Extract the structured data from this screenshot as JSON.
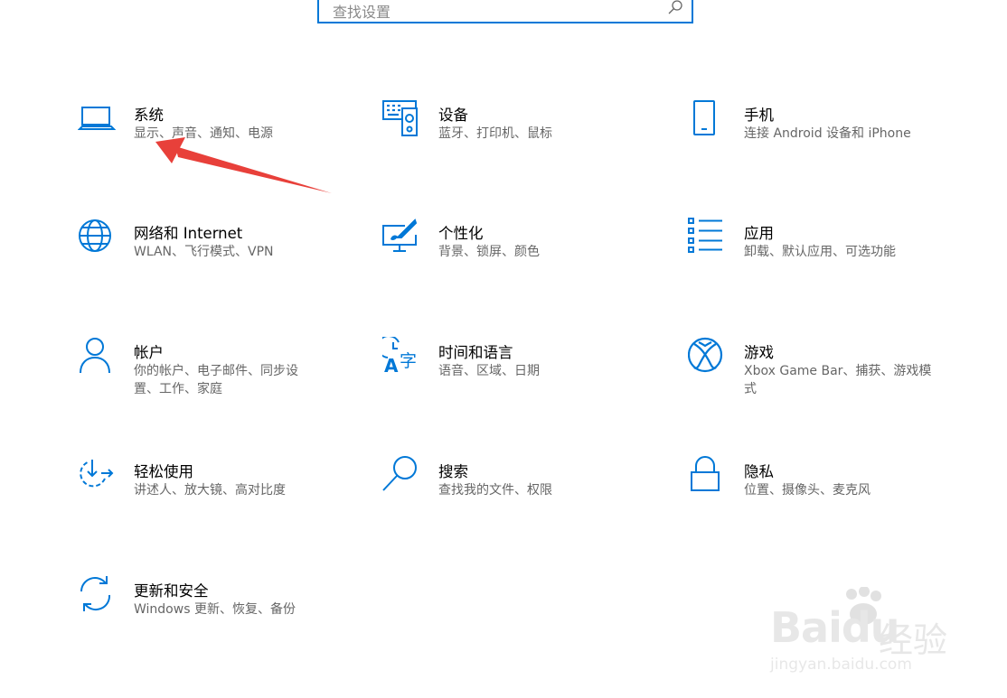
{
  "search": {
    "placeholder": "查找设置",
    "icon": "search-icon"
  },
  "accent_color": "#0078d7",
  "categories": [
    {
      "id": "system",
      "title": "系统",
      "desc": "显示、声音、通知、电源",
      "icon": "laptop-icon"
    },
    {
      "id": "devices",
      "title": "设备",
      "desc": "蓝牙、打印机、鼠标",
      "icon": "keyboard-speaker-icon"
    },
    {
      "id": "phone",
      "title": "手机",
      "desc": "连接 Android 设备和 iPhone",
      "icon": "phone-icon"
    },
    {
      "id": "network",
      "title": "网络和 Internet",
      "desc": "WLAN、飞行模式、VPN",
      "icon": "globe-icon"
    },
    {
      "id": "personalization",
      "title": "个性化",
      "desc": "背景、锁屏、颜色",
      "icon": "paint-monitor-icon"
    },
    {
      "id": "apps",
      "title": "应用",
      "desc": "卸载、默认应用、可选功能",
      "icon": "app-list-icon"
    },
    {
      "id": "accounts",
      "title": "帐户",
      "desc": "你的帐户、电子邮件、同步设置、工作、家庭",
      "icon": "person-icon"
    },
    {
      "id": "time-language",
      "title": "时间和语言",
      "desc": "语音、区域、日期",
      "icon": "clock-language-icon"
    },
    {
      "id": "gaming",
      "title": "游戏",
      "desc": "Xbox Game Bar、捕获、游戏模式",
      "icon": "xbox-icon"
    },
    {
      "id": "ease-of-access",
      "title": "轻松使用",
      "desc": "讲述人、放大镜、高对比度",
      "icon": "ease-of-access-icon"
    },
    {
      "id": "search",
      "title": "搜索",
      "desc": "查找我的文件、权限",
      "icon": "magnifier-icon"
    },
    {
      "id": "privacy",
      "title": "隐私",
      "desc": "位置、摄像头、麦克风",
      "icon": "lock-icon"
    },
    {
      "id": "update-security",
      "title": "更新和安全",
      "desc": "Windows 更新、恢复、备份",
      "icon": "sync-icon"
    }
  ],
  "annotation": {
    "type": "red-arrow",
    "color": "#e8403a",
    "target": "system"
  },
  "watermark": {
    "brand": "Baidu",
    "cn": "经验",
    "url": "jingyan.baidu.com"
  }
}
